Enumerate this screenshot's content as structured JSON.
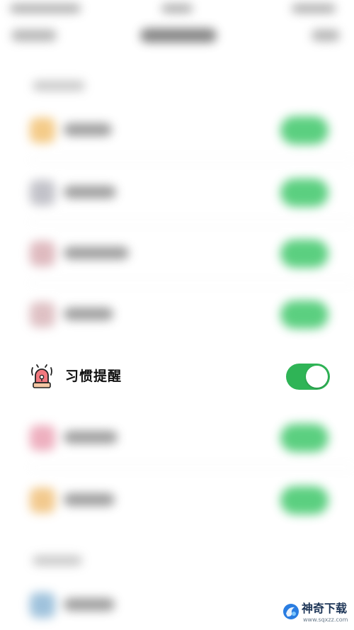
{
  "focused_setting": {
    "label": "习惯提醒",
    "icon": "alarm-bell-icon",
    "toggle_state": "on",
    "toggle_color": "#2fb456"
  },
  "blurred_settings": {
    "row_icons": [
      "yellow-icon",
      "gray-icon",
      "pink-icon",
      "pink-icon",
      "pink-icon",
      "orange-icon",
      "blue-icon"
    ],
    "toggle_color": "#3fc76a"
  },
  "watermark": {
    "brand": "神奇下载",
    "url": "www.sqxzz.com",
    "logo_icon": "blue-swirl-logo-icon"
  }
}
